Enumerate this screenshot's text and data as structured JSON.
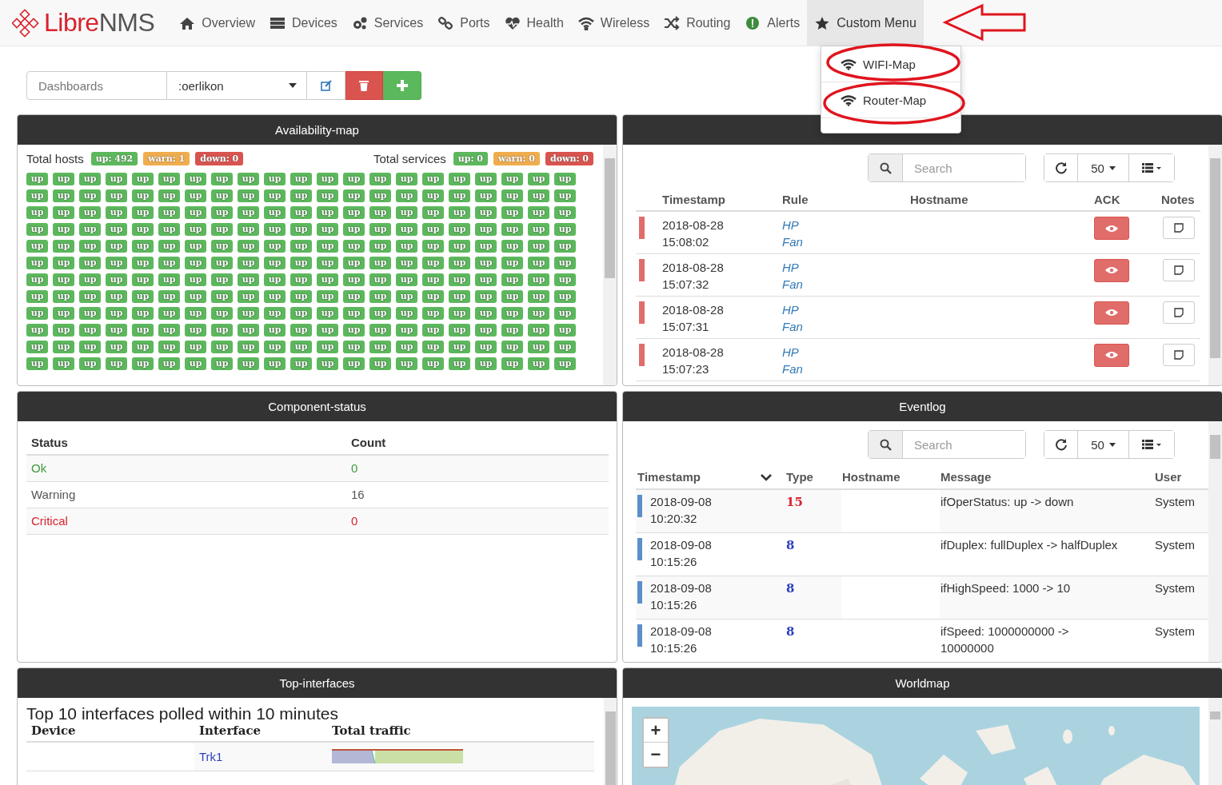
{
  "brand": {
    "first": "Libre",
    "second": "NMS"
  },
  "nav": [
    {
      "label": "Overview",
      "selected": false
    },
    {
      "label": "Devices",
      "selected": false
    },
    {
      "label": "Services",
      "selected": false
    },
    {
      "label": "Ports",
      "selected": false
    },
    {
      "label": "Health",
      "selected": false
    },
    {
      "label": "Wireless",
      "selected": false
    },
    {
      "label": "Routing",
      "selected": false
    },
    {
      "label": "Alerts",
      "selected": false
    },
    {
      "label": "Custom Menu",
      "selected": true
    }
  ],
  "custom_menu": {
    "expanded": true,
    "items": [
      "WIFI-Map",
      "Router-Map"
    ]
  },
  "dashboard_bar": {
    "label": "Dashboards",
    "value": ":oerlikon"
  },
  "availability": {
    "title": "Availability-map",
    "hosts_label": "Total hosts",
    "host_badges": [
      {
        "text": "up: 492",
        "kind": "up"
      },
      {
        "text": "warn: 1",
        "kind": "warn"
      },
      {
        "text": "down: 0",
        "kind": "down"
      }
    ],
    "services_label": "Total services",
    "service_badges": [
      {
        "text": "up: 0",
        "kind": "up"
      },
      {
        "text": "warn: 0",
        "kind": "warn"
      },
      {
        "text": "down: 0",
        "kind": "down"
      }
    ],
    "tile_rows": [
      [
        "up",
        "up",
        "up",
        "up",
        "up",
        "up",
        "up",
        "up",
        "up",
        "up",
        "up",
        "up",
        "up",
        "up",
        "up",
        "up",
        "up",
        "up",
        "up",
        "up",
        "up"
      ],
      [
        "up",
        "up",
        "up",
        "up",
        "up",
        "up",
        "up",
        "up",
        "up",
        "up",
        "up",
        "up",
        "up",
        "up",
        "up",
        "up",
        "up",
        "up",
        "up",
        "up",
        "up"
      ],
      [
        "up",
        "up",
        "up",
        "up",
        "up",
        "up",
        "up",
        "up",
        "up",
        "up",
        "up",
        "up",
        "up",
        "up",
        "up",
        "up",
        "up",
        "up",
        "up",
        "up",
        "up"
      ],
      [
        "up",
        "up",
        "up",
        "up",
        "up",
        "up",
        "up",
        "up",
        "up",
        "up",
        "up",
        "up",
        "up",
        "up",
        "up",
        "up",
        "up",
        "up",
        "up",
        "up",
        "up"
      ],
      [
        "up",
        "up",
        "up",
        "up",
        "up",
        "up",
        "up",
        "up",
        "up",
        "up",
        "up",
        "up",
        "up",
        "up",
        "up",
        "up",
        "up",
        "up",
        "up",
        "up",
        "up"
      ],
      [
        "up",
        "up",
        "up",
        "up",
        "up",
        "up",
        "up",
        "up",
        "up",
        "up",
        "up",
        "up",
        "up",
        "up",
        "up",
        "up",
        "up",
        "up",
        "up",
        "up",
        "up"
      ],
      [
        "up",
        "up",
        "up",
        "up",
        "up",
        "up",
        "up",
        "up",
        "up",
        "up",
        "up",
        "up",
        "up",
        "up",
        "up",
        "up",
        "up",
        "up",
        "up",
        "up",
        "up"
      ],
      [
        "up",
        "up",
        "up",
        "up",
        "up",
        "up",
        "up",
        "up",
        "up",
        "up",
        "up",
        "up",
        "up",
        "up",
        "up",
        "up",
        "up",
        "up",
        "up",
        "up",
        "up"
      ],
      [
        "up",
        "up",
        "up",
        "up",
        "up",
        "up",
        "up",
        "up",
        "up",
        "up",
        "up",
        "up",
        "up",
        "up",
        "up",
        "up",
        "up",
        "up",
        "up",
        "up",
        "up"
      ],
      [
        "up",
        "up",
        "up",
        "up",
        "up",
        "up",
        "up",
        "up",
        "up",
        "up",
        "up",
        "up",
        "up",
        "up",
        "up",
        "up",
        "up",
        "up",
        "up",
        "up",
        "up"
      ],
      [
        "up",
        "up",
        "up",
        "up",
        "up",
        "up",
        "up",
        "up",
        "up",
        "up",
        "up",
        "up",
        "up",
        "up",
        "up",
        "up",
        "up",
        "up",
        "up",
        "up",
        "up"
      ],
      [
        "up",
        "up",
        "up",
        "up",
        "up",
        "up",
        "up",
        "up",
        "up",
        "up",
        "up",
        "up",
        "up",
        "up",
        "up",
        "up",
        "up",
        "up",
        "up",
        "up",
        "up"
      ]
    ]
  },
  "alerts": {
    "search": {
      "placeholder": "Search"
    },
    "page_size": "50",
    "columns": [
      "Timestamp",
      "Rule",
      "Hostname",
      "ACK",
      "Notes"
    ],
    "rows": [
      {
        "timestamp": "2018-08-28 15:08:02",
        "rule": "HP Fan"
      },
      {
        "timestamp": "2018-08-28 15:07:32",
        "rule": "HP Fan"
      },
      {
        "timestamp": "2018-08-28 15:07:31",
        "rule": "HP Fan"
      },
      {
        "timestamp": "2018-08-28 15:07:23",
        "rule": "HP Fan"
      }
    ]
  },
  "component_status": {
    "title": "Component-status",
    "columns": [
      "Status",
      "Count"
    ],
    "rows": [
      {
        "status": "Ok",
        "count": "0",
        "kind": "ok"
      },
      {
        "status": "Warning",
        "count": "16",
        "kind": "warning"
      },
      {
        "status": "Critical",
        "count": "0",
        "kind": "critical"
      }
    ]
  },
  "eventlog": {
    "title": "Eventlog",
    "search": {
      "placeholder": "Search"
    },
    "page_size": "50",
    "columns": [
      "Timestamp",
      "Type",
      "Hostname",
      "Message",
      "User"
    ],
    "rows": [
      {
        "timestamp": "2018-09-08 10:20:32",
        "type": "15",
        "color": "#d9232e",
        "message": "ifOperStatus: up -> down",
        "user": "System"
      },
      {
        "timestamp": "2018-09-08 10:15:26",
        "type": "8",
        "color": "#2d3fbf",
        "message": "ifDuplex: fullDuplex -> halfDuplex",
        "user": "System"
      },
      {
        "timestamp": "2018-09-08 10:15:26",
        "type": "8",
        "color": "#2d3fbf",
        "message": "ifHighSpeed: 1000 -> 10",
        "user": "System"
      },
      {
        "timestamp": "2018-09-08 10:15:26",
        "type": "8",
        "color": "#2d3fbf",
        "message": "ifSpeed: 1000000000 -> 10000000",
        "user": "System"
      }
    ]
  },
  "top_interfaces": {
    "title": "Top-interfaces",
    "heading": "Top 10 interfaces polled within 10 minutes",
    "columns": [
      "Device",
      "Interface",
      "Total traffic"
    ],
    "rows": [
      {
        "interface": "Trk1"
      }
    ]
  },
  "worldmap": {
    "title": "Worldmap",
    "zoom_in": "+",
    "zoom_out": "−"
  }
}
